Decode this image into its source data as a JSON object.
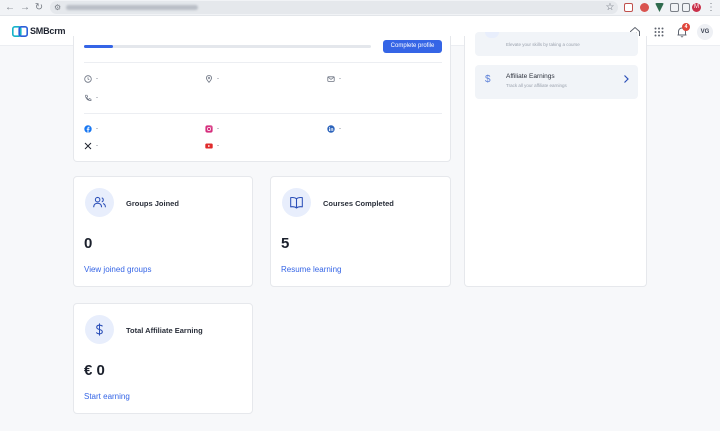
{
  "browser": {
    "back_icon": "arrow-left-icon",
    "forward_icon": "arrow-right-icon",
    "reload_icon": "reload-icon",
    "profile_initial": "M"
  },
  "header": {
    "logo_text": "SMBcrm",
    "notification_count": "4",
    "avatar_initials": "VG"
  },
  "profile": {
    "progress": 0.1,
    "complete_button": "Complete profile",
    "contact": {
      "time": "-",
      "location": "-",
      "email": "-",
      "phone": "-"
    },
    "social": {
      "facebook": "-",
      "instagram": "-",
      "linkedin": "-",
      "x": "-",
      "youtube": "-"
    }
  },
  "stats": {
    "groups": {
      "title": "Groups Joined",
      "value": "0",
      "link": "View joined groups"
    },
    "courses": {
      "title": "Courses Completed",
      "value": "5",
      "link": "Resume learning"
    },
    "affiliate": {
      "title": "Total Affiliate Earning",
      "value": "€ 0",
      "link": "Start earning"
    }
  },
  "side_panel": {
    "partial_item_sub": "Elevate your skills by taking a course",
    "affiliate": {
      "title": "Affiliate Earnings",
      "subtitle": "Track all your affiliate earnings"
    }
  },
  "colors": {
    "accent": "#3565e6",
    "icon_bg": "#e8eefc",
    "badge": "#e0453a"
  }
}
